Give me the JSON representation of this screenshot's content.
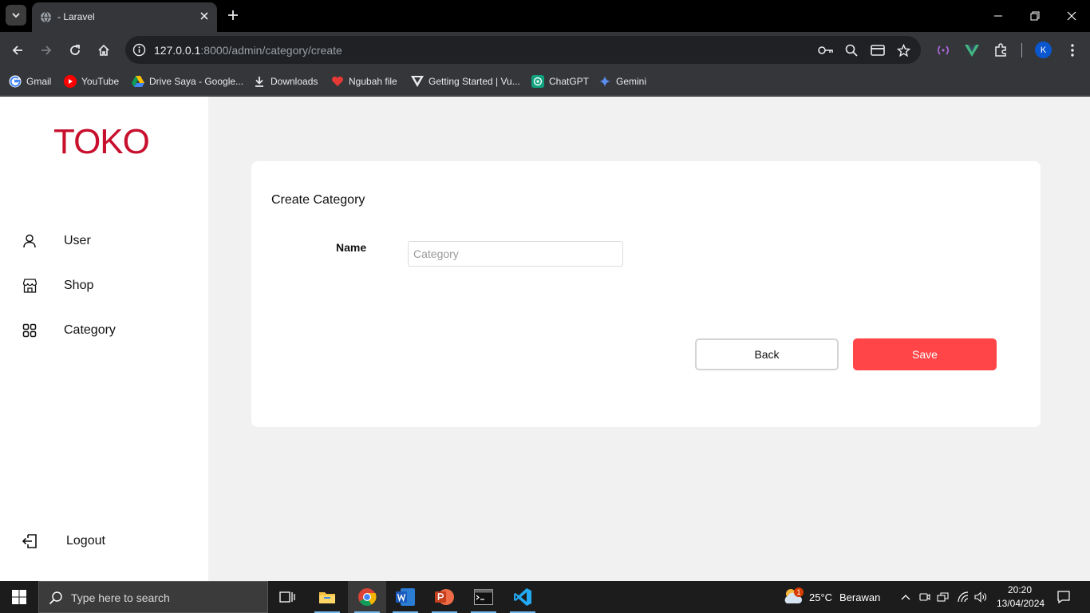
{
  "browser": {
    "tab_title": "- Laravel",
    "url_host": "127.0.0.1",
    "url_rest": ":8000/admin/category/create",
    "bookmarks": [
      {
        "label": "Gmail",
        "icon": "gmail-icon"
      },
      {
        "label": "YouTube",
        "icon": "youtube-icon"
      },
      {
        "label": "Drive Saya - Google...",
        "icon": "google-drive-icon"
      },
      {
        "label": "Downloads",
        "icon": "download-icon"
      },
      {
        "label": "Ngubah file",
        "icon": "heart-icon"
      },
      {
        "label": "Getting Started | Vu...",
        "icon": "vuetify-icon"
      },
      {
        "label": "ChatGPT",
        "icon": "chatgpt-icon"
      },
      {
        "label": "Gemini",
        "icon": "gemini-icon"
      }
    ],
    "profile_initial": "K"
  },
  "sidebar": {
    "logo": "TOKO",
    "items": [
      {
        "label": "User",
        "icon": "user-icon"
      },
      {
        "label": "Shop",
        "icon": "shop-icon"
      },
      {
        "label": "Category",
        "icon": "category-grid-icon"
      }
    ],
    "logout_label": "Logout"
  },
  "form": {
    "title": "Create Category",
    "name_label": "Name",
    "name_placeholder": "Category",
    "name_value": "",
    "back_label": "Back",
    "save_label": "Save"
  },
  "colors": {
    "brand": "#c8102e",
    "save_button": "#ff4548",
    "page_bg": "#f1f1f1"
  },
  "taskbar": {
    "search_placeholder": "Type here to search",
    "weather_temp": "25°C",
    "weather_desc": "Berawan",
    "weather_badge": "1",
    "time": "20:20",
    "date": "13/04/2024"
  }
}
